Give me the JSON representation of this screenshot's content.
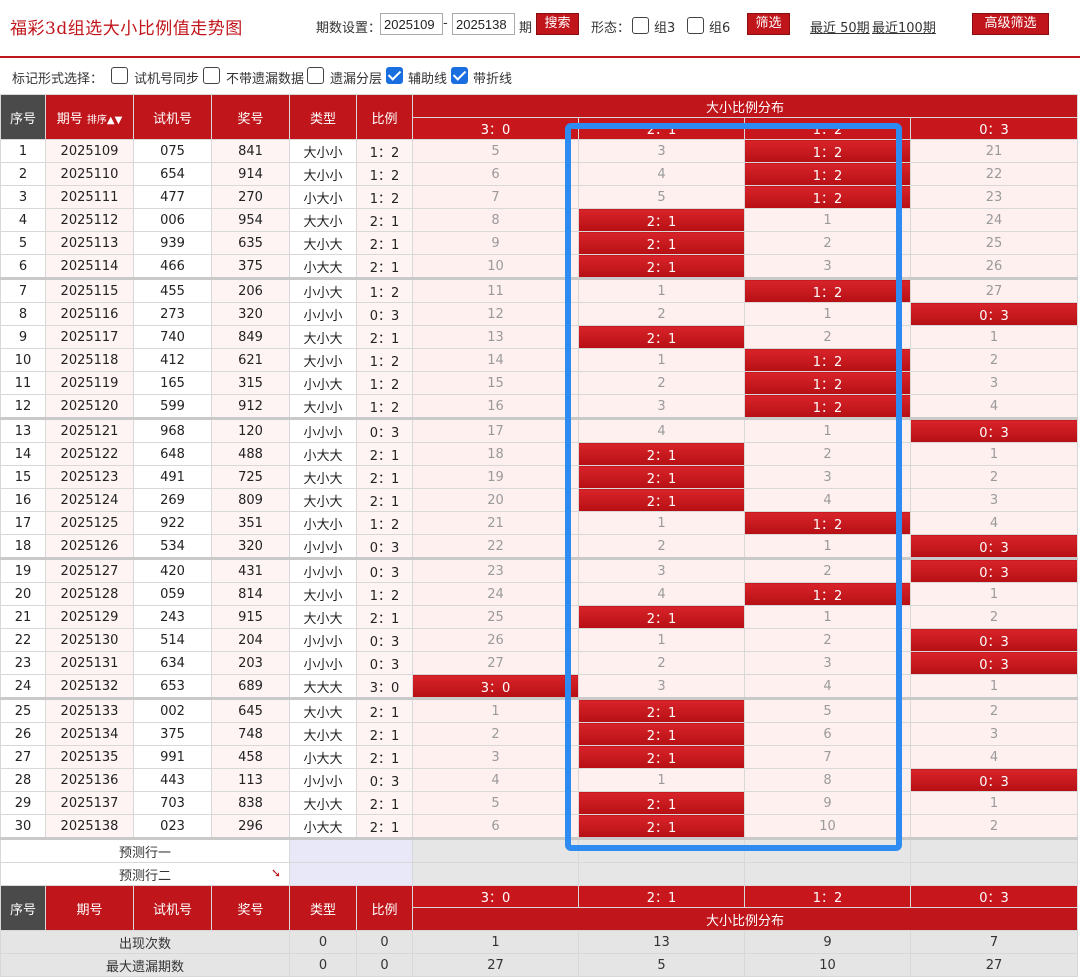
{
  "header": {
    "title": "福彩3d组选大小比例值走势图",
    "period_label": "期数设置：",
    "period_start": "2025109",
    "dash": "-",
    "period_end": "2025138",
    "period_unit": "期",
    "search_button": "搜索",
    "form_label": "形态：",
    "group3_label": "组3",
    "group6_label": "组6",
    "filter_button": "筛选",
    "recent50": "最近 50期",
    "recent100": "最近100期",
    "advanced_button": "高级筛选"
  },
  "mark_bar": {
    "label": "标记形式选择：",
    "options": [
      {
        "label": "试机号同步",
        "checked": false
      },
      {
        "label": "不带遗漏数据",
        "checked": false
      },
      {
        "label": "遗漏分层",
        "checked": false
      },
      {
        "label": "辅助线",
        "checked": true
      },
      {
        "label": "带折线",
        "checked": true
      }
    ]
  },
  "table": {
    "headers": {
      "seq": "序号",
      "period": "期号",
      "sort": "排序",
      "test_no": "试机号",
      "prize_no": "奖号",
      "type": "类型",
      "ratio": "比例",
      "dist_title": "大小比例分布",
      "dist_cols": [
        "3：0",
        "2：1",
        "1：2",
        "0：3"
      ]
    },
    "rows": [
      {
        "seq": "1",
        "period": "2025109",
        "test": "075",
        "prize": "841",
        "type": "大小小",
        "ratio": "1：2",
        "d": [
          "5",
          "3",
          "1：2",
          "21"
        ]
      },
      {
        "seq": "2",
        "period": "2025110",
        "test": "654",
        "prize": "914",
        "type": "大小小",
        "ratio": "1：2",
        "d": [
          "6",
          "4",
          "1：2",
          "22"
        ]
      },
      {
        "seq": "3",
        "period": "2025111",
        "test": "477",
        "prize": "270",
        "type": "小大小",
        "ratio": "1：2",
        "d": [
          "7",
          "5",
          "1：2",
          "23"
        ]
      },
      {
        "seq": "4",
        "period": "2025112",
        "test": "006",
        "prize": "954",
        "type": "大大小",
        "ratio": "2：1",
        "d": [
          "8",
          "2：1",
          "1",
          "24"
        ]
      },
      {
        "seq": "5",
        "period": "2025113",
        "test": "939",
        "prize": "635",
        "type": "大小大",
        "ratio": "2：1",
        "d": [
          "9",
          "2：1",
          "2",
          "25"
        ]
      },
      {
        "seq": "6",
        "period": "2025114",
        "test": "466",
        "prize": "375",
        "type": "小大大",
        "ratio": "2：1",
        "d": [
          "10",
          "2：1",
          "3",
          "26"
        ]
      },
      {
        "seq": "7",
        "period": "2025115",
        "test": "455",
        "prize": "206",
        "type": "小小大",
        "ratio": "1：2",
        "d": [
          "11",
          "1",
          "1：2",
          "27"
        ]
      },
      {
        "seq": "8",
        "period": "2025116",
        "test": "273",
        "prize": "320",
        "type": "小小小",
        "ratio": "0：3",
        "d": [
          "12",
          "2",
          "1",
          "0：3"
        ]
      },
      {
        "seq": "9",
        "period": "2025117",
        "test": "740",
        "prize": "849",
        "type": "大小大",
        "ratio": "2：1",
        "d": [
          "13",
          "2：1",
          "2",
          "1"
        ]
      },
      {
        "seq": "10",
        "period": "2025118",
        "test": "412",
        "prize": "621",
        "type": "大小小",
        "ratio": "1：2",
        "d": [
          "14",
          "1",
          "1：2",
          "2"
        ]
      },
      {
        "seq": "11",
        "period": "2025119",
        "test": "165",
        "prize": "315",
        "type": "小小大",
        "ratio": "1：2",
        "d": [
          "15",
          "2",
          "1：2",
          "3"
        ]
      },
      {
        "seq": "12",
        "period": "2025120",
        "test": "599",
        "prize": "912",
        "type": "大小小",
        "ratio": "1：2",
        "d": [
          "16",
          "3",
          "1：2",
          "4"
        ]
      },
      {
        "seq": "13",
        "period": "2025121",
        "test": "968",
        "prize": "120",
        "type": "小小小",
        "ratio": "0：3",
        "d": [
          "17",
          "4",
          "1",
          "0：3"
        ]
      },
      {
        "seq": "14",
        "period": "2025122",
        "test": "648",
        "prize": "488",
        "type": "小大大",
        "ratio": "2：1",
        "d": [
          "18",
          "2：1",
          "2",
          "1"
        ]
      },
      {
        "seq": "15",
        "period": "2025123",
        "test": "491",
        "prize": "725",
        "type": "大小大",
        "ratio": "2：1",
        "d": [
          "19",
          "2：1",
          "3",
          "2"
        ]
      },
      {
        "seq": "16",
        "period": "2025124",
        "test": "269",
        "prize": "809",
        "type": "大小大",
        "ratio": "2：1",
        "d": [
          "20",
          "2：1",
          "4",
          "3"
        ]
      },
      {
        "seq": "17",
        "period": "2025125",
        "test": "922",
        "prize": "351",
        "type": "小大小",
        "ratio": "1：2",
        "d": [
          "21",
          "1",
          "1：2",
          "4"
        ]
      },
      {
        "seq": "18",
        "period": "2025126",
        "test": "534",
        "prize": "320",
        "type": "小小小",
        "ratio": "0：3",
        "d": [
          "22",
          "2",
          "1",
          "0：3"
        ]
      },
      {
        "seq": "19",
        "period": "2025127",
        "test": "420",
        "prize": "431",
        "type": "小小小",
        "ratio": "0：3",
        "d": [
          "23",
          "3",
          "2",
          "0：3"
        ]
      },
      {
        "seq": "20",
        "period": "2025128",
        "test": "059",
        "prize": "814",
        "type": "大小小",
        "ratio": "1：2",
        "d": [
          "24",
          "4",
          "1：2",
          "1"
        ]
      },
      {
        "seq": "21",
        "period": "2025129",
        "test": "243",
        "prize": "915",
        "type": "大小大",
        "ratio": "2：1",
        "d": [
          "25",
          "2：1",
          "1",
          "2"
        ]
      },
      {
        "seq": "22",
        "period": "2025130",
        "test": "514",
        "prize": "204",
        "type": "小小小",
        "ratio": "0：3",
        "d": [
          "26",
          "1",
          "2",
          "0：3"
        ]
      },
      {
        "seq": "23",
        "period": "2025131",
        "test": "634",
        "prize": "203",
        "type": "小小小",
        "ratio": "0：3",
        "d": [
          "27",
          "2",
          "3",
          "0：3"
        ]
      },
      {
        "seq": "24",
        "period": "2025132",
        "test": "653",
        "prize": "689",
        "type": "大大大",
        "ratio": "3：0",
        "d": [
          "3：0",
          "3",
          "4",
          "1"
        ]
      },
      {
        "seq": "25",
        "period": "2025133",
        "test": "002",
        "prize": "645",
        "type": "大小大",
        "ratio": "2：1",
        "d": [
          "1",
          "2：1",
          "5",
          "2"
        ]
      },
      {
        "seq": "26",
        "period": "2025134",
        "test": "375",
        "prize": "748",
        "type": "大小大",
        "ratio": "2：1",
        "d": [
          "2",
          "2：1",
          "6",
          "3"
        ]
      },
      {
        "seq": "27",
        "period": "2025135",
        "test": "991",
        "prize": "458",
        "type": "小大大",
        "ratio": "2：1",
        "d": [
          "3",
          "2：1",
          "7",
          "4"
        ]
      },
      {
        "seq": "28",
        "period": "2025136",
        "test": "443",
        "prize": "113",
        "type": "小小小",
        "ratio": "0：3",
        "d": [
          "4",
          "1",
          "8",
          "0：3"
        ]
      },
      {
        "seq": "29",
        "period": "2025137",
        "test": "703",
        "prize": "838",
        "type": "大小大",
        "ratio": "2：1",
        "d": [
          "5",
          "2：1",
          "9",
          "1"
        ]
      },
      {
        "seq": "30",
        "period": "2025138",
        "test": "023",
        "prize": "296",
        "type": "小大大",
        "ratio": "2：1",
        "d": [
          "6",
          "2：1",
          "10",
          "2"
        ]
      }
    ],
    "predict_rows": [
      "预测行一",
      "预测行二"
    ],
    "stats": [
      {
        "label": "出现次数",
        "type": "0",
        "ratio": "0",
        "d": [
          "1",
          "13",
          "9",
          "7"
        ]
      },
      {
        "label": "最大遗漏期数",
        "type": "0",
        "ratio": "0",
        "d": [
          "27",
          "5",
          "10",
          "27"
        ]
      }
    ]
  },
  "colors": {
    "accent": "#c0151b",
    "highlight": "#2e8bf2"
  },
  "icons": {
    "sort": "sort-arrows-icon",
    "predict_arrow": "arrow-down-icon"
  }
}
